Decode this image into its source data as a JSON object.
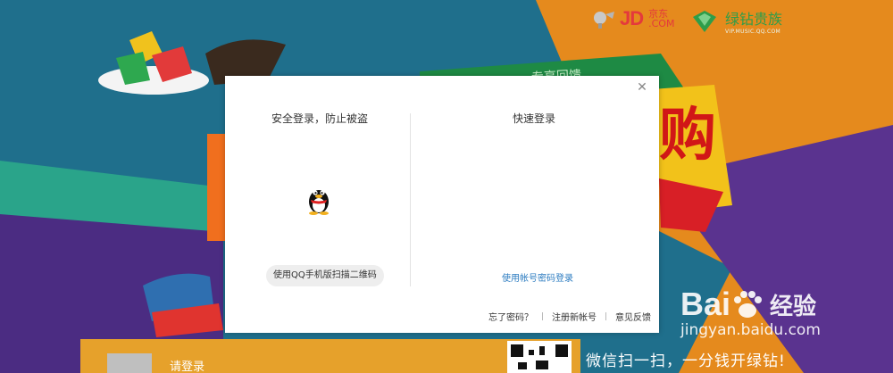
{
  "background": {
    "brand_jd": "JD",
    "brand_jd_cn": "京东",
    "brand_jd_sub": ".COM",
    "brand_vip": "绿钻贵族",
    "brand_vip_url": "VIP.MUSIC.QQ.COM",
    "ribbon_text": "专享回馈",
    "big_char": "购",
    "login_text": "请登录",
    "slogan": "微信扫一扫，一分钱开绿钻!"
  },
  "watermark": {
    "logo_latin": "Bai",
    "logo_cn": "经验",
    "url": "jingyan.baidu.com"
  },
  "dialog": {
    "left_title": "安全登录，防止被盗",
    "right_title": "快速登录",
    "scan_button": "使用QQ手机版扫描二维码",
    "account_link": "使用帐号密码登录",
    "footer": {
      "forgot": "忘了密码？",
      "register": "注册新帐号",
      "feedback": "意见反馈"
    },
    "close_icon": "close-icon"
  },
  "colors": {
    "accent_link": "#2b7bc0",
    "jd_red": "#e4393c",
    "vip_green": "#2e9d4a"
  }
}
